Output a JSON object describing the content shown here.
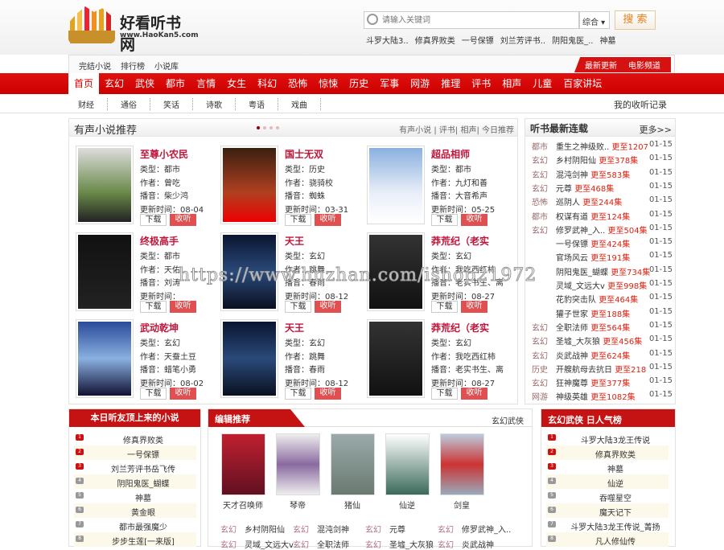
{
  "header": {
    "site_name": "好看听书网",
    "site_url": "www.HaoKan5.com",
    "search_placeholder": "请输入关键词",
    "search_scope": "综合 ▾",
    "search_button": "搜 索",
    "hot_words": [
      "斗罗大陆3..",
      "修真界败类",
      "一号保镖",
      "刘兰芳评书..",
      "阴阳鬼医_..",
      "神墓"
    ]
  },
  "top_nav": {
    "left": [
      "完结小说",
      "排行榜",
      "小说库"
    ],
    "right": [
      "最新更新",
      "电影频道"
    ]
  },
  "main_nav": [
    "首页",
    "玄幻",
    "武侠",
    "都市",
    "言情",
    "女生",
    "科幻",
    "恐怖",
    "惊悚",
    "历史",
    "军事",
    "网游",
    "推理",
    "评书",
    "相声",
    "儿童",
    "百家讲坛"
  ],
  "sub_nav": {
    "items": [
      "财经",
      "通俗",
      "笑话",
      "诗歌",
      "粤语",
      "戏曲"
    ],
    "history": "我的收听记录"
  },
  "recommend": {
    "title": "有声小说推荐",
    "links": "有声小说 | 评书| 相声| 今日推荐",
    "download": "下载",
    "listen": "收听",
    "books": [
      {
        "title": "至尊小农民",
        "type": "类型：都市",
        "author": "作者：曾吃",
        "reader": "播音：柴少鸿",
        "updated": "更新时间：08-04"
      },
      {
        "title": "国士无双",
        "type": "类型：历史",
        "author": "作者：骁骑校",
        "reader": "播音：蜘蛛",
        "updated": "更新时间：03-31"
      },
      {
        "title": "超品相师",
        "type": "类型：都市",
        "author": "作者：九灯和善",
        "reader": "播音：大音希声",
        "updated": "更新时间：05-25"
      },
      {
        "title": "终极高手",
        "type": "类型：都市",
        "author": "作者：天佑",
        "reader": "播音：刘涛",
        "updated": "更新时间："
      },
      {
        "title": "天王",
        "type": "类型：玄幻",
        "author": "作者：跳舞",
        "reader": "播音：春雨",
        "updated": "更新时间：08-12"
      },
      {
        "title": "莽荒纪（老实",
        "type": "类型：玄幻",
        "author": "作者：我吃西红柿",
        "reader": "播音：老实书生、离",
        "updated": "更新时间：08-27"
      },
      {
        "title": "武动乾坤",
        "type": "类型：玄幻",
        "author": "作者：天蚕土豆",
        "reader": "播音：蜡笔小勇",
        "updated": "更新时间：08-02"
      },
      {
        "title": "天王",
        "type": "类型：玄幻",
        "author": "作者：跳舞",
        "reader": "播音：春雨",
        "updated": "更新时间：08-12"
      },
      {
        "title": "莽荒纪（老实",
        "type": "类型：玄幻",
        "author": "作者：我吃西红柿",
        "reader": "播音：老实书生、离",
        "updated": "更新时间：08-27"
      }
    ]
  },
  "latest": {
    "title": "听书最新连载",
    "more": "更多>>",
    "items": [
      {
        "cat": "都市",
        "name": "重生之神级败..",
        "ep": "更至1207",
        "date": "01-15"
      },
      {
        "cat": "玄幻",
        "name": "乡村阴阳仙",
        "ep": "更至378集",
        "date": "01-15"
      },
      {
        "cat": "玄幻",
        "name": "混沌剑神",
        "ep": "更至583集",
        "date": "01-15"
      },
      {
        "cat": "玄幻",
        "name": "元尊",
        "ep": "更至468集",
        "date": "01-15"
      },
      {
        "cat": "恐怖",
        "name": "巡阴人",
        "ep": "更至244集",
        "date": "01-15"
      },
      {
        "cat": "都市",
        "name": "权谋有道",
        "ep": "更至124集",
        "date": "01-15"
      },
      {
        "cat": "玄幻",
        "name": "修罗武神_入..",
        "ep": "更至504集",
        "date": "01-15"
      },
      {
        "cat": "",
        "name": "一号保镖",
        "ep": "更至424集",
        "date": "01-15"
      },
      {
        "cat": "",
        "name": "官场风云",
        "ep": "更至191集",
        "date": "01-15"
      },
      {
        "cat": "",
        "name": "阴阳鬼医_蝴蝶",
        "ep": "更至734集",
        "date": "01-15"
      },
      {
        "cat": "",
        "name": "灵域_文远大v",
        "ep": "更至998集",
        "date": "01-15"
      },
      {
        "cat": "",
        "name": "花豹突击队",
        "ep": "更至464集",
        "date": "01-15"
      },
      {
        "cat": "",
        "name": "獾子世家",
        "ep": "更至188集",
        "date": "01-15"
      },
      {
        "cat": "玄幻",
        "name": "全职法师",
        "ep": "更至564集",
        "date": "01-15"
      },
      {
        "cat": "玄幻",
        "name": "圣墟_大灰狼",
        "ep": "更至456集",
        "date": "01-15"
      },
      {
        "cat": "玄幻",
        "name": "炎武战神",
        "ep": "更至624集",
        "date": "01-15"
      },
      {
        "cat": "历史",
        "name": "开艘航母去抗日",
        "ep": "更至218",
        "date": "01-15"
      },
      {
        "cat": "玄幻",
        "name": "狂神魔尊",
        "ep": "更至377集",
        "date": "01-15"
      },
      {
        "cat": "网游",
        "name": "神级英雄",
        "ep": "更至1082集",
        "date": "01-15"
      }
    ]
  },
  "top_today": {
    "title": "本日听友顶上来的小说",
    "items": [
      "修真界败类",
      "一号保镖",
      "刘兰芳评书岳飞传",
      "阴阳鬼医_蝴蝶",
      "神墓",
      "黄金眼",
      "都市最强魔少",
      "步步生莲[一来版]"
    ]
  },
  "editor": {
    "title": "编辑推荐",
    "tag": "玄幻武侠",
    "picks": [
      "天才召唤师",
      "琴帝",
      "猪仙",
      "仙逆",
      "剑皇"
    ],
    "list": [
      [
        "玄幻",
        "乡村阴阳仙"
      ],
      [
        "玄幻",
        "混沌剑神"
      ],
      [
        "玄幻",
        "元尊"
      ],
      [
        "玄幻",
        "修罗武神_入.."
      ],
      [
        "玄幻",
        "灵域_文远大v"
      ],
      [
        "玄幻",
        "全职法师"
      ],
      [
        "玄幻",
        "圣墟_大灰狼"
      ],
      [
        "玄幻",
        "炎武战神"
      ]
    ]
  },
  "popular": {
    "title": "玄幻武侠 日人气榜",
    "items": [
      "斗罗大陆3龙王传说",
      "修真界败类",
      "神墓",
      "仙逆",
      "吞噬星空",
      "魔天记下",
      "斗罗大陆3龙王传说_菁扬",
      "凡人修仙传"
    ]
  },
  "watermark": "https://www.huzhan.com/ishop21972"
}
